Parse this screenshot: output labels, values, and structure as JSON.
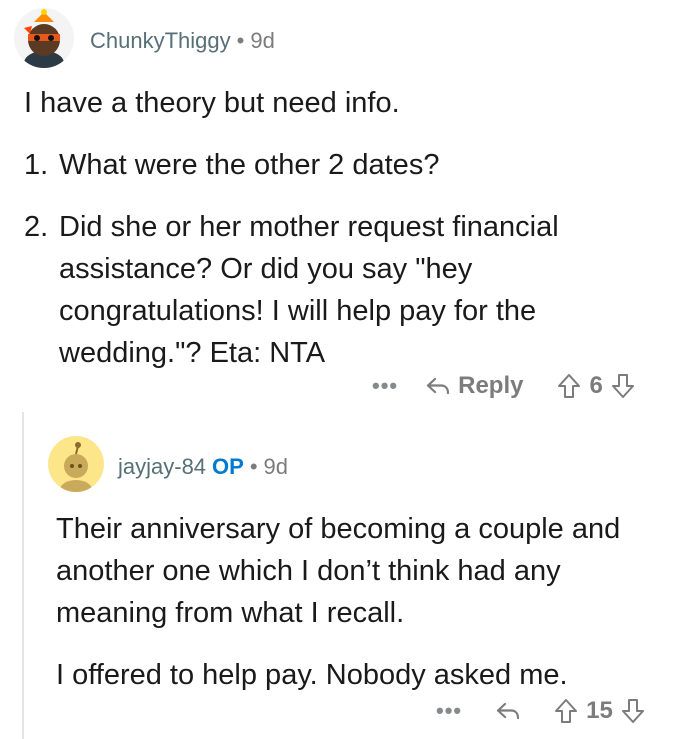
{
  "comments": [
    {
      "username": "ChunkyThiggy",
      "separator": "•",
      "age": "9d",
      "paragraph": "I have a theory but need info.",
      "list": [
        {
          "num": "1.",
          "text": "What were the other 2 dates?"
        },
        {
          "num": "2.",
          "text": "Did she or her mother request financial assistance? Or did you say \"hey congratulations! I will help pay for the wedding.\"? Eta: NTA"
        }
      ],
      "actions": {
        "more": "•••",
        "reply": "Reply",
        "score": "6"
      }
    },
    {
      "username": "jayjay-84",
      "op_badge": "OP",
      "separator": "•",
      "age": "9d",
      "paragraphs": [
        "Their anniversary of becoming a couple and another one which I don’t think had any meaning from what I recall.",
        "I offered to help pay. Nobody asked me."
      ],
      "actions": {
        "more": "•••",
        "score": "15"
      }
    }
  ],
  "colors": {
    "op": "#0079d3",
    "meta": "#7c7c7c",
    "text": "#1a1a1b"
  }
}
